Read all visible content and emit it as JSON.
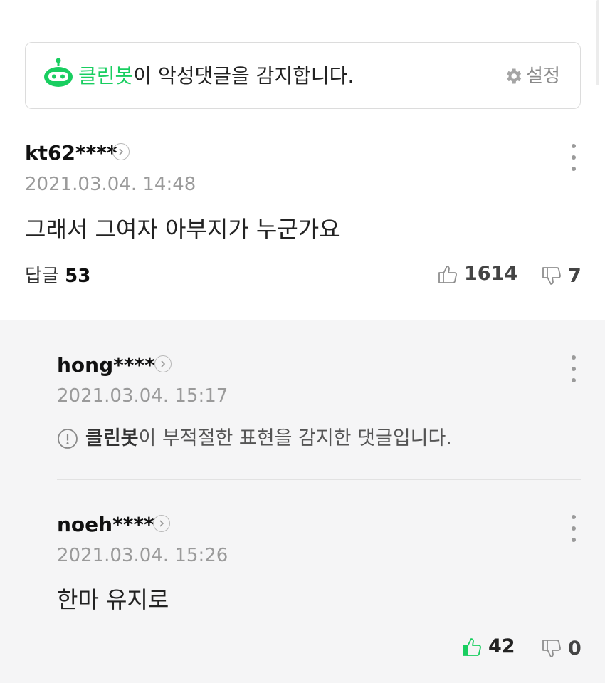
{
  "cleanbot": {
    "name": "클린봇",
    "message": "이 악성댓글을 감지합니다.",
    "settings_label": "설정"
  },
  "comments": [
    {
      "username": "kt62****",
      "date": "2021.03.04. 14:48",
      "content": "그래서 그여자 아부지가 누군가요",
      "reply_label": "답글",
      "reply_count": "53",
      "likes": "1614",
      "dislikes": "7"
    }
  ],
  "replies": [
    {
      "username": "hong****",
      "date": "2021.03.04. 15:17",
      "notice_bot": "클린봇",
      "notice_text": "이 부적절한 표현을 감지한 댓글입니다."
    },
    {
      "username": "noeh****",
      "date": "2021.03.04. 15:26",
      "content": "한마 유지로",
      "likes": "42",
      "dislikes": "0"
    }
  ],
  "colors": {
    "accent": "#19ce60",
    "muted": "#9a9a9a"
  }
}
